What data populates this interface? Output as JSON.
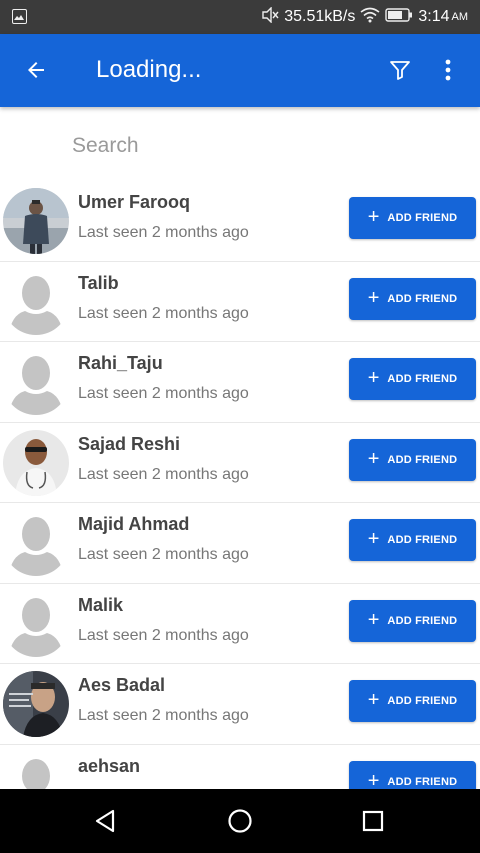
{
  "status_bar": {
    "speed": "35.51kB/s",
    "time": "3:14",
    "ampm": "AM"
  },
  "app_bar": {
    "title": "Loading..."
  },
  "search": {
    "placeholder": "Search"
  },
  "colors": {
    "primary": "#1565d8",
    "status_bar": "#3b3b3b",
    "nav_bar": "#000000"
  },
  "users": [
    {
      "name": "Umer Farooq",
      "last_seen": "Last seen 2 months ago",
      "avatar": "photo",
      "button": "ADD FRIEND"
    },
    {
      "name": "Talib",
      "last_seen": "Last seen 2 months ago",
      "avatar": "placeholder",
      "button": "ADD FRIEND"
    },
    {
      "name": "Rahi_Taju",
      "last_seen": "Last seen 2 months ago",
      "avatar": "placeholder",
      "button": "ADD FRIEND"
    },
    {
      "name": "Sajad Reshi",
      "last_seen": "Last seen 2 months ago",
      "avatar": "photo",
      "button": "ADD FRIEND"
    },
    {
      "name": "Majid Ahmad",
      "last_seen": "Last seen 2 months ago",
      "avatar": "placeholder",
      "button": "ADD FRIEND"
    },
    {
      "name": "Malik",
      "last_seen": "Last seen 2 months ago",
      "avatar": "placeholder",
      "button": "ADD FRIEND"
    },
    {
      "name": "Aes Badal",
      "last_seen": "Last seen 2 months ago",
      "avatar": "photo",
      "button": "ADD FRIEND"
    },
    {
      "name": "aehsan",
      "last_seen": "",
      "avatar": "placeholder",
      "button": "ADD FRIEND"
    }
  ],
  "icons": {
    "back": "arrow-back-icon",
    "filter": "filter-icon",
    "more": "more-vert-icon",
    "add": "plus-icon",
    "nav_back": "triangle-back-icon",
    "nav_home": "circle-home-icon",
    "nav_recents": "square-recents-icon"
  }
}
